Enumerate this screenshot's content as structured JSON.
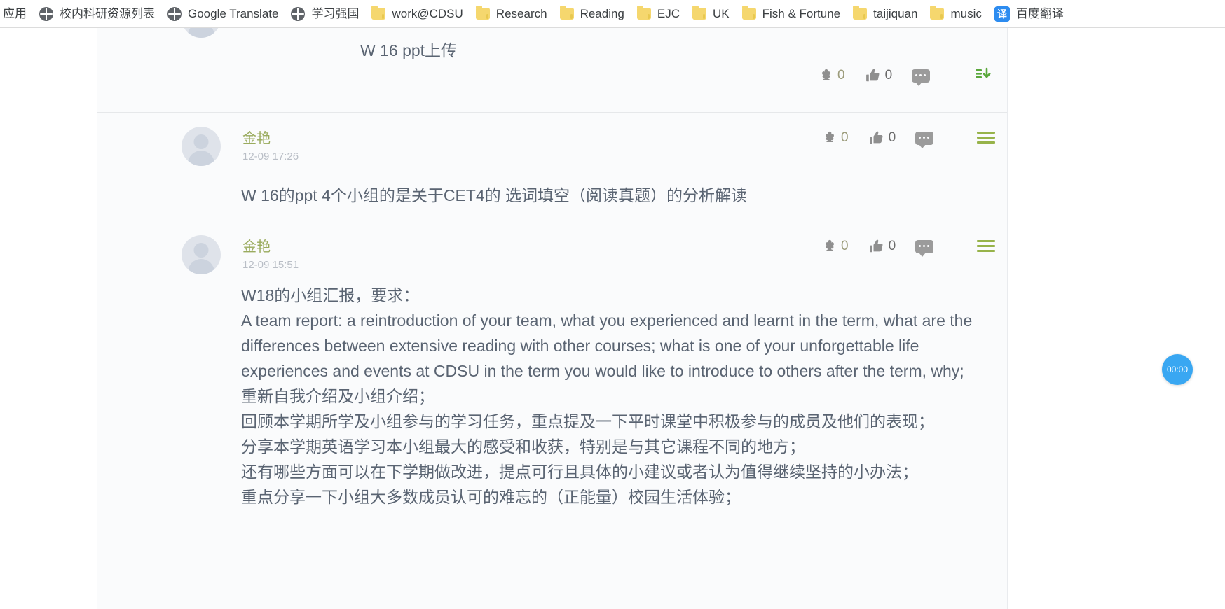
{
  "bookmarks": {
    "items": [
      {
        "label": "应用",
        "icon": "apps-icon",
        "truncated": true
      },
      {
        "label": "校内科研资源列表",
        "icon": "globe-icon"
      },
      {
        "label": "Google Translate",
        "icon": "globe-icon"
      },
      {
        "label": "学习强国",
        "icon": "globe-icon"
      },
      {
        "label": "work@CDSU",
        "icon": "folder-icon"
      },
      {
        "label": "Research",
        "icon": "folder-icon"
      },
      {
        "label": "Reading",
        "icon": "folder-icon"
      },
      {
        "label": "EJC",
        "icon": "folder-icon"
      },
      {
        "label": "UK",
        "icon": "folder-icon"
      },
      {
        "label": "Fish & Fortune",
        "icon": "folder-icon"
      },
      {
        "label": "taijiquan",
        "icon": "folder-icon"
      },
      {
        "label": "music",
        "icon": "folder-icon"
      },
      {
        "label": "百度翻译",
        "icon": "baidu-translate-icon",
        "badge": "译"
      }
    ]
  },
  "feed": {
    "posts": [
      {
        "id": "post-1",
        "body": "W 16 ppt上传",
        "actions": {
          "flower_count": "0",
          "like_count": "0",
          "comment_icon": "comment-icon",
          "menu_icon": "download-icon"
        }
      },
      {
        "id": "post-2",
        "author": "金艳",
        "time": "12-09 17:26",
        "body": "W 16的ppt 4个小组的是关于CET4的 选词填空（阅读真题）的分析解读",
        "actions": {
          "flower_count": "0",
          "like_count": "0",
          "comment_icon": "comment-icon",
          "menu_icon": "menu-icon"
        }
      },
      {
        "id": "post-3",
        "author": "金艳",
        "time": "12-09 15:51",
        "body": "W18的小组汇报，要求：\nA team report: a reintroduction of your team, what you experienced and learnt in the term, what are the differences between extensive reading with other courses; what is one of your unforgettable life experiences and events at CDSU in the term you would like to introduce to others after the term, why;\n重新自我介绍及小组介绍；\n回顾本学期所学及小组参与的学习任务，重点提及一下平时课堂中积极参与的成员及他们的表现；\n分享本学期英语学习本小组最大的感受和收获，特别是与其它课程不同的地方；\n还有哪些方面可以在下学期做改进，提点可行且具体的小建议或者认为值得继续坚持的小办法；\n重点分享一下小组大多数成员认可的难忘的（正能量）校园生活体验；",
        "actions": {
          "flower_count": "0",
          "like_count": "0",
          "comment_icon": "comment-icon",
          "menu_icon": "menu-icon"
        }
      }
    ]
  },
  "timer_badge": {
    "label": "00:00"
  },
  "colors": {
    "author": "#9aab5e",
    "body_text": "#5a6472",
    "menu_green": "#97b34a",
    "badge_blue": "#39a7f2",
    "feed_bg": "#fafbfc"
  }
}
